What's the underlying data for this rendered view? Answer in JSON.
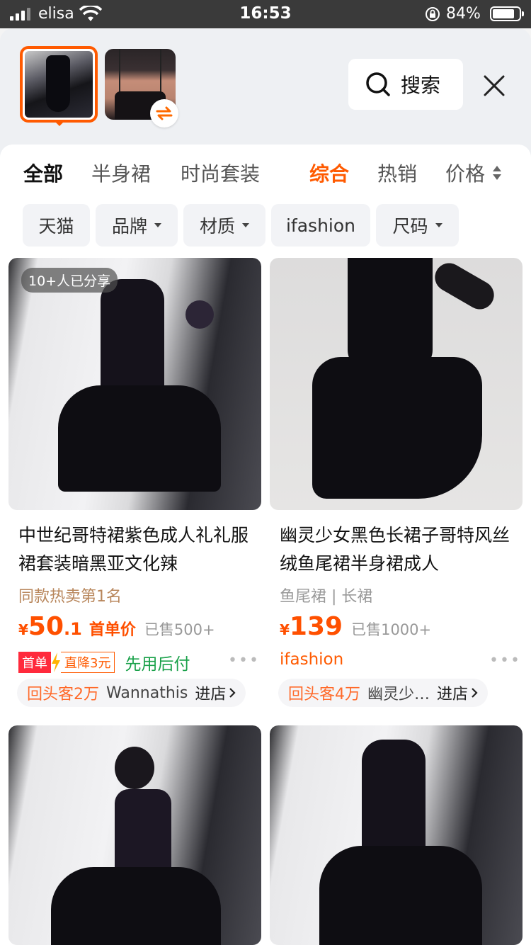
{
  "status_bar": {
    "carrier": "elisa",
    "time": "16:53",
    "battery": "84%"
  },
  "header": {
    "search_label": "搜索"
  },
  "category_tabs": [
    "全部",
    "半身裙",
    "时尚套装"
  ],
  "sort_tabs": [
    "综合",
    "热销",
    "价格"
  ],
  "filters": [
    "天猫",
    "品牌",
    "材质",
    "ifashion",
    "尺码"
  ],
  "products": [
    {
      "share_tag": "10+人已分享",
      "title": "中世纪哥特裙紫色成人礼礼服裙套装暗黑亚文化辣",
      "subline": "同款热卖第1名",
      "price_symbol": "¥",
      "price_int": "50",
      "price_dec": ".1",
      "price_tag": "首单价",
      "sold": "已售500+",
      "badge_first": "首单",
      "badge_drop": "直降3元",
      "pay_later": "先用后付",
      "repeat": "回头客2万",
      "shop": "Wannathis",
      "enter": "进店"
    },
    {
      "title": "幽灵少女黑色长裙子哥特风丝绒鱼尾裙半身裙成人",
      "subline": "鱼尾裙 | 长裙",
      "price_symbol": "¥",
      "price_int": "139",
      "sold": "已售1000+",
      "brand_tag": "ifashion",
      "repeat": "回头客4万",
      "shop": "幽灵少…",
      "enter": "进店"
    }
  ],
  "colors": {
    "accent": "#ff5a00",
    "price": "#ff5000",
    "pay_later": "#1aa14a"
  }
}
